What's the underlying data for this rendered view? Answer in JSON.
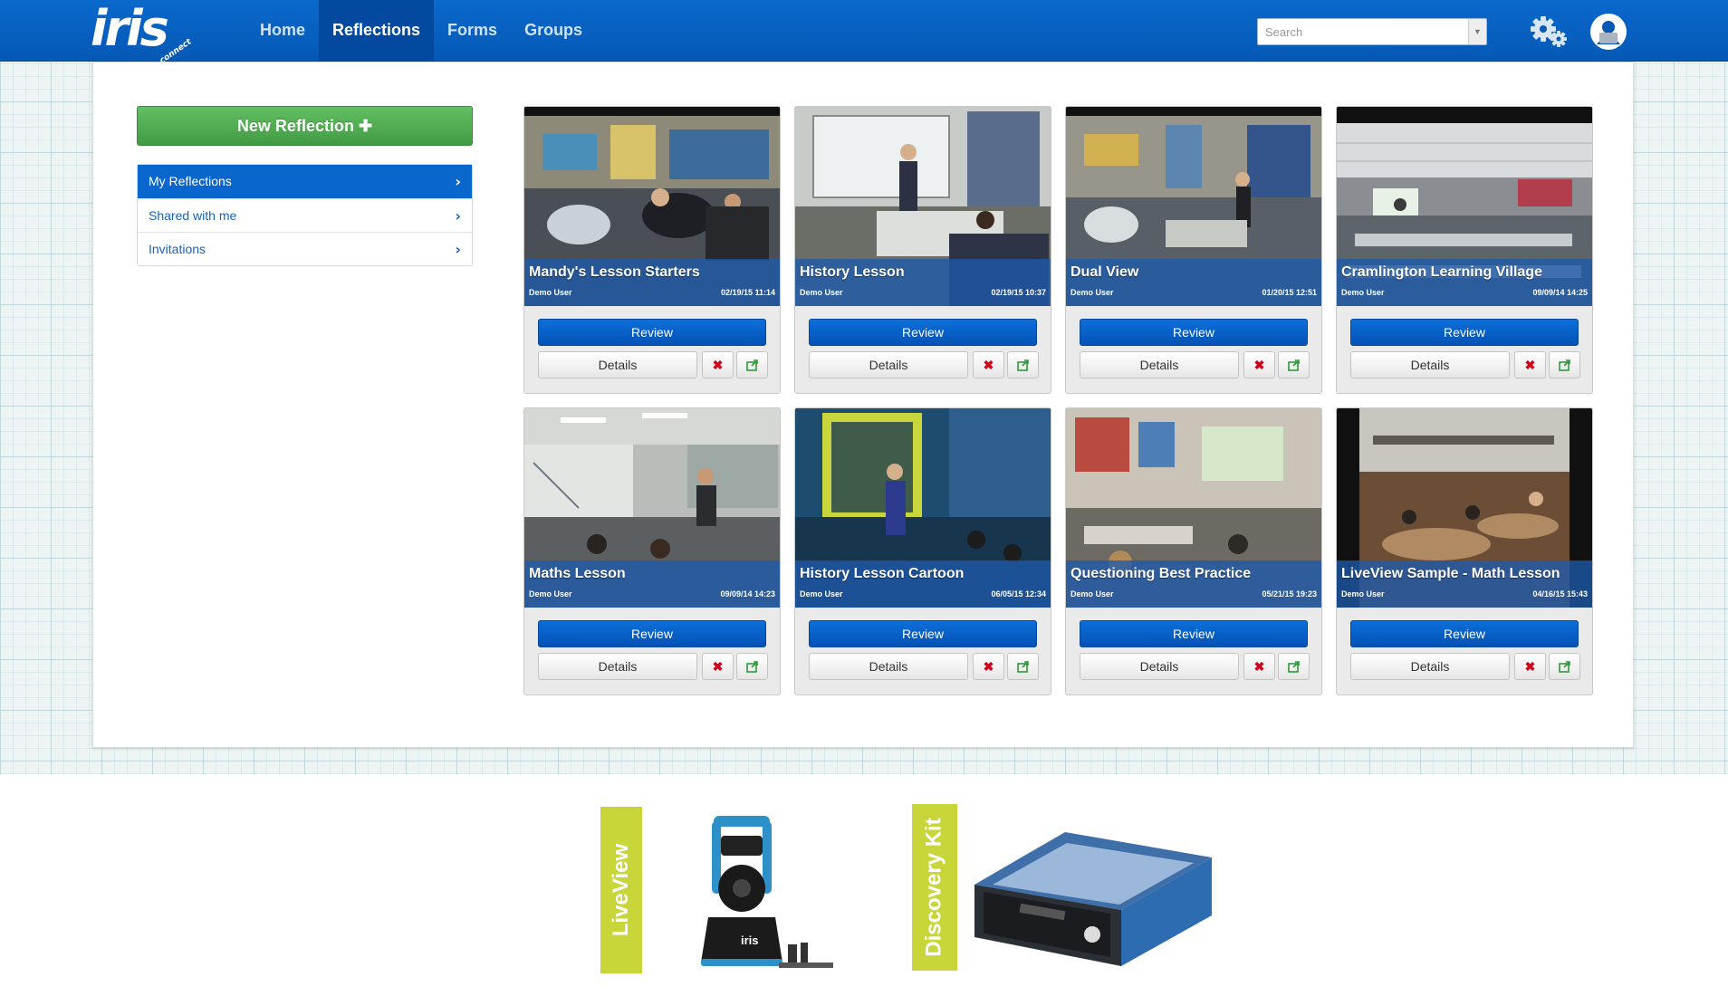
{
  "app": {
    "logo_text": "iris",
    "logo_sub": "connect"
  },
  "nav": {
    "items": [
      {
        "label": "Home",
        "active": false
      },
      {
        "label": "Reflections",
        "active": true
      },
      {
        "label": "Forms",
        "active": false
      },
      {
        "label": "Groups",
        "active": false
      }
    ],
    "search_placeholder": "Search"
  },
  "sidebar": {
    "new_button_label": "New Reflection",
    "new_button_icon": "plus-icon",
    "items": [
      {
        "label": "My Reflections",
        "active": true
      },
      {
        "label": "Shared with me",
        "active": false
      },
      {
        "label": "Invitations",
        "active": false
      }
    ]
  },
  "cards": [
    {
      "title": "Mandy's Lesson Starters",
      "user": "Demo User",
      "date": "02/19/15 11:14",
      "scene": "classroom-a"
    },
    {
      "title": "History Lesson",
      "user": "Demo User",
      "date": "02/19/15 10:37",
      "scene": "whiteboard"
    },
    {
      "title": "Dual View",
      "user": "Demo User",
      "date": "01/20/15 12:51",
      "scene": "classroom-b"
    },
    {
      "title": "Cramlington Learning Village",
      "user": "Demo User",
      "date": "09/09/14 14:25",
      "scene": "hall"
    },
    {
      "title": "Maths Lesson",
      "user": "Demo User",
      "date": "09/09/14 14:23",
      "scene": "maths"
    },
    {
      "title": "History Lesson Cartoon",
      "user": "Demo User",
      "date": "06/05/15 12:34",
      "scene": "cartoon"
    },
    {
      "title": "Questioning Best Practice",
      "user": "Demo User",
      "date": "05/21/15 19:23",
      "scene": "primary"
    },
    {
      "title": "LiveView Sample - Math Lesson",
      "user": "Demo User",
      "date": "04/16/15 15:43",
      "scene": "liveview"
    }
  ],
  "card_actions": {
    "review_label": "Review",
    "details_label": "Details",
    "delete_icon": "close-icon",
    "share_icon": "share-icon"
  },
  "footer": {
    "promo_1": "LiveView",
    "promo_1_product_logo": "iris",
    "promo_2": "Discovery Kit"
  },
  "colors": {
    "nav_blue": "#0559b5",
    "nav_active": "#0449a0",
    "new_button_green": "#4aa84c",
    "review_blue": "#0452b5",
    "delete_red": "#d0021b",
    "share_green": "#2e9a3a",
    "promo_lime": "#c8d63a"
  }
}
